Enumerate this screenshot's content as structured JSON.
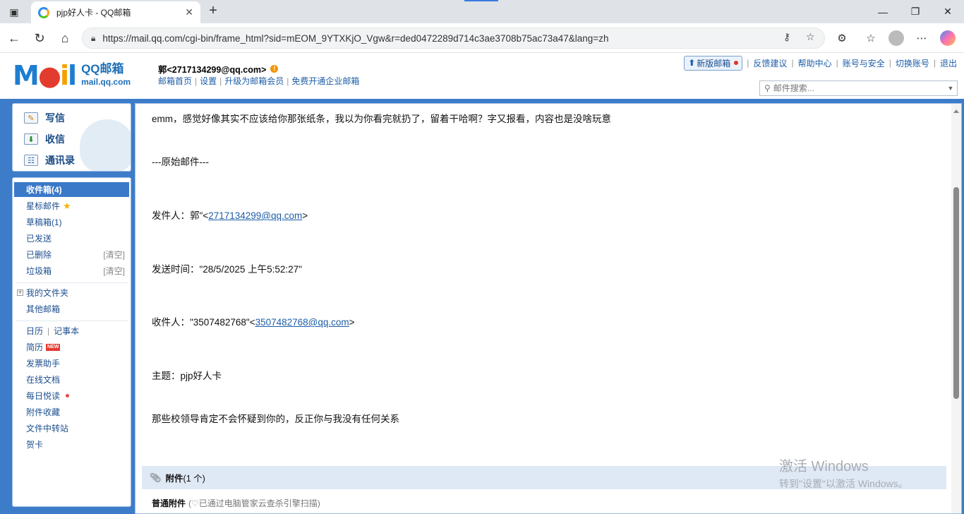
{
  "browser": {
    "tab_title": "pjp好人卡 - QQ邮箱",
    "url": "https://mail.qq.com/cgi-bin/frame_html?sid=mEOM_9YTXKjO_Vgw&r=ded0472289d714c3ae3708b75ac73a47&lang=zh"
  },
  "header": {
    "logo_mark": "M",
    "logo_i": "i",
    "logo_l": "l",
    "brand_cn": "QQ邮箱",
    "brand_en": "mail.qq.com",
    "user": "郭<2717134299@qq.com>",
    "user_warn": "!",
    "links": [
      "邮箱首页",
      "设置",
      "升级为邮箱会员",
      "免费开通企业邮箱"
    ],
    "new_version": "新版邮箱",
    "top_links": [
      "反馈建议",
      "帮助中心",
      "账号与安全",
      "切换账号",
      "退出"
    ],
    "search_placeholder": "邮件搜索..."
  },
  "quick_actions": [
    "写信",
    "收信",
    "通讯录"
  ],
  "folders": {
    "inbox": "收件箱(4)",
    "starred": "星标邮件",
    "drafts": "草稿箱(1)",
    "sent": "已发送",
    "deleted": "已删除",
    "spam": "垃圾箱",
    "clear_label": "[清空]",
    "my_folders": "我的文件夹",
    "other_mail": "其他邮箱",
    "calendar": "日历",
    "notes": "记事本",
    "resume": "简历",
    "new_badge": "NEW",
    "invoice": "发票助手",
    "online_docs": "在线文档",
    "daily_read": "每日悦读",
    "attachments": "附件收藏",
    "transfer": "文件中转站",
    "cards": "贺卡"
  },
  "message": {
    "line1": "emm，感觉好像其实不应该给你那张纸条，我以为你看完就扔了，留着干哈啊？字又报看，内容也是没啥玩意",
    "original_marker": "---原始邮件---",
    "from_prefix": "发件人：郭\"<",
    "from_email": "2717134299@qq.com",
    "from_suffix": ">",
    "sent_time": "发送时间：\"28/5/2025 上午5:52:27\"",
    "to_prefix": "收件人：\"3507482768\"<",
    "to_email": "3507482768@qq.com",
    "to_suffix": ">",
    "subject": "主题：pjp好人卡",
    "body": "那些校领导肯定不会怀疑到你的，反正你与我没有任何关系"
  },
  "attachments": {
    "title": "附件",
    "count": "(1 个)",
    "normal_label": "普通附件",
    "scan_note": "(♡已通过电脑管家云查杀引擎扫描)"
  },
  "watermark": {
    "line1": "激活 Windows",
    "line2": "转到\"设置\"以激活 Windows。"
  }
}
